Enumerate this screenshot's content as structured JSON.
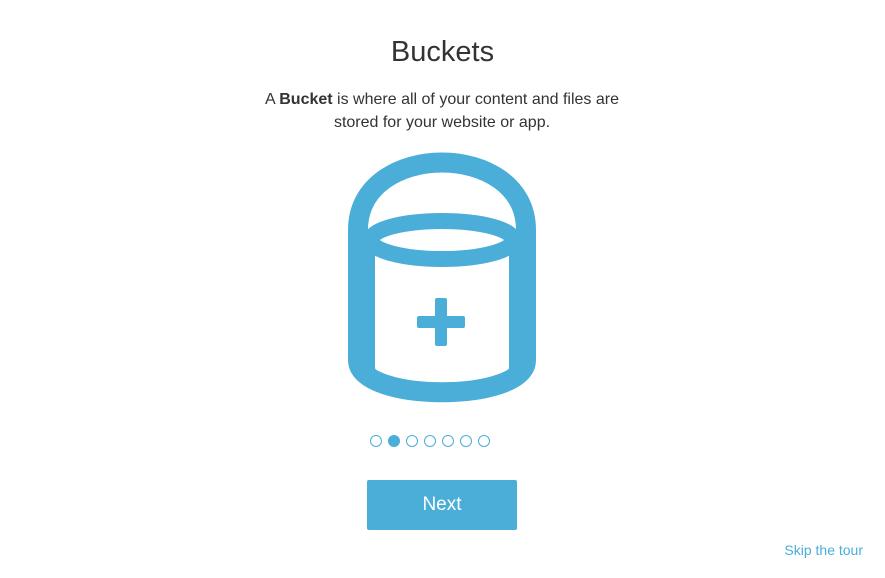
{
  "tour": {
    "title": "Buckets",
    "description_prefix": "A ",
    "description_bold": "Bucket",
    "description_suffix": " is where all of your content and files are stored for your website or app.",
    "illustration_icon": "bucket-add-icon",
    "steps_total": 7,
    "current_step": 2,
    "next_label": "Next",
    "skip_label": "Skip the tour"
  },
  "colors": {
    "accent": "#4aaed9",
    "text": "#333333",
    "background": "#ffffff"
  }
}
